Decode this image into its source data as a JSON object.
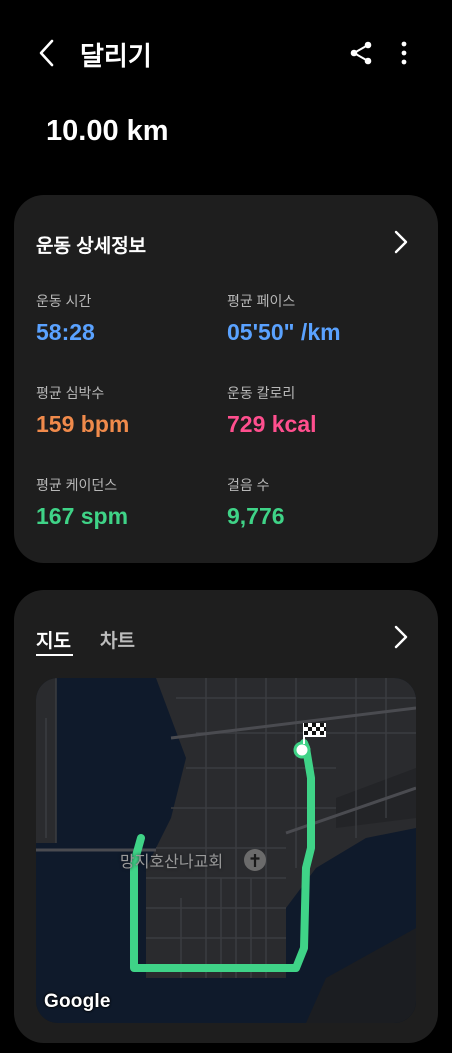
{
  "header": {
    "title": "달리기",
    "distance": "10.00 km"
  },
  "details": {
    "title": "운동 상세정보",
    "stats": [
      {
        "label": "운동 시간",
        "value": "58:28",
        "color": "#5aa2ff"
      },
      {
        "label": "평균 페이스",
        "value": "05'50\" /km",
        "color": "#5aa2ff"
      },
      {
        "label": "평균 심박수",
        "value": "159 bpm",
        "color": "#f08a4b"
      },
      {
        "label": "운동 칼로리",
        "value": "729 kcal",
        "color": "#ff4f8e"
      },
      {
        "label": "평균 케이던스",
        "value": "167 spm",
        "color": "#3fd387"
      },
      {
        "label": "걸음 수",
        "value": "9,776",
        "color": "#3fd387"
      }
    ]
  },
  "map_section": {
    "tabs": [
      "지도",
      "차트"
    ],
    "active_tab": "지도",
    "poi_label": "망지호산나교회",
    "attribution": "Google",
    "route_color": "#3fd387"
  },
  "icons": {
    "back": "back-arrow-icon",
    "share": "share-icon",
    "more": "more-vert-icon",
    "chevron": "chevron-right-icon",
    "finish": "checkered-flag-icon",
    "poi": "church-icon"
  }
}
